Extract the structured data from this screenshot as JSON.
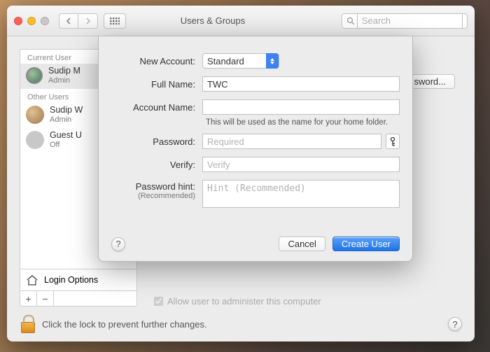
{
  "window": {
    "title": "Users & Groups",
    "search_placeholder": "Search"
  },
  "sidebar": {
    "current_label": "Current User",
    "other_label": "Other Users",
    "current": {
      "name": "Sudip M",
      "role": "Admin"
    },
    "others": [
      {
        "name": "Sudip W",
        "role": "Admin"
      },
      {
        "name": "Guest U",
        "role": "Off"
      }
    ],
    "login_options": "Login Options"
  },
  "main": {
    "password_button": "sword...",
    "allow_admin": "Allow user to administer this computer"
  },
  "footer": {
    "lock_text": "Click the lock to prevent further changes."
  },
  "sheet": {
    "labels": {
      "new_account": "New Account:",
      "full_name": "Full Name:",
      "account_name": "Account Name:",
      "password": "Password:",
      "verify": "Verify:",
      "hint": "Password hint:",
      "recommended": "(Recommended)"
    },
    "new_account_value": "Standard",
    "full_name_value": "TWC",
    "account_name_note": "This will be used as the name for your home folder.",
    "password_placeholder": "Required",
    "verify_placeholder": "Verify",
    "hint_placeholder": "Hint (Recommended)",
    "cancel": "Cancel",
    "create": "Create User"
  }
}
